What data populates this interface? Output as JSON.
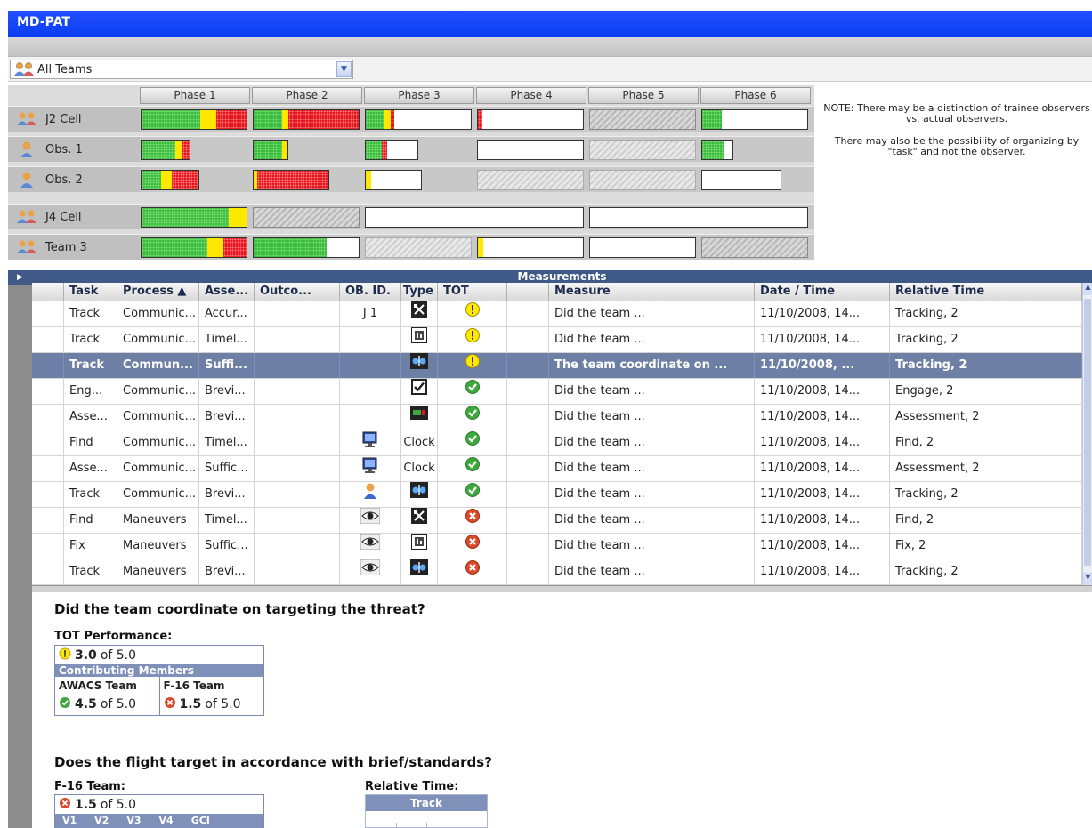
{
  "app": {
    "title": "MD-PAT"
  },
  "team_selector": {
    "value": "All Teams",
    "icon": "team-group-icon"
  },
  "phases": [
    "Phase 1",
    "Phase 2",
    "Phase 3",
    "Phase 4",
    "Phase 5",
    "Phase 6"
  ],
  "phase_rows": [
    {
      "label": "J2 Cell",
      "icon": "team-group-icon"
    },
    {
      "label": "Obs. 1",
      "icon": "single-observer-icon"
    },
    {
      "label": "Obs. 2",
      "icon": "single-observer-icon"
    },
    {
      "label": "J4 Cell",
      "icon": "team-group-icon"
    },
    {
      "label": "Team 3",
      "icon": "team-group-icon"
    }
  ],
  "note": {
    "line1": "NOTE:  There may be a distinction of trainee observers vs. actual observers.",
    "line2": "There may also be the possibility of organizing by \"task\" and not the observer."
  },
  "measurements": {
    "title": "Measurements",
    "columns": [
      "Task",
      "Process ▲",
      "Asse...",
      "Outco...",
      "OB. ID.",
      "Type",
      "TOT",
      "",
      "Measure",
      "Date / Time",
      "Relative Time"
    ],
    "rows": [
      {
        "task": "Track",
        "process": "Communic...",
        "asse": "Accur...",
        "outco": "",
        "obid": "J 1",
        "obicon": "",
        "type": "",
        "typeicon": "x-axis-icon",
        "tot": "warning",
        "measure": "Did the team ...",
        "date": "11/10/2008, 14...",
        "rel": "Tracking, 2",
        "selected": false
      },
      {
        "task": "Track",
        "process": "Communic...",
        "asse": "Timel...",
        "outco": "",
        "obid": "",
        "obicon": "",
        "type": "",
        "typeicon": "chart-box-icon",
        "tot": "warning",
        "measure": "Did the team ...",
        "date": "11/10/2008, 14...",
        "rel": "Tracking, 2",
        "selected": false
      },
      {
        "task": "Track",
        "process": "Commun...",
        "asse": "Suffi...",
        "outco": "",
        "obid": "",
        "obicon": "",
        "type": "",
        "typeicon": "slider-icon",
        "tot": "warning",
        "measure": "The team coordinate on ...",
        "date": "11/10/2008, ...",
        "rel": "Tracking, 2",
        "selected": true
      },
      {
        "task": "Eng...",
        "process": "Communic...",
        "asse": "Brevi...",
        "outco": "",
        "obid": "",
        "obicon": "",
        "type": "",
        "typeicon": "checkbox-icon",
        "tot": "ok",
        "measure": "Did the team ...",
        "date": "11/10/2008, 14...",
        "rel": "Engage, 2",
        "selected": false
      },
      {
        "task": "Asse...",
        "process": "Communic...",
        "asse": "Brevi...",
        "outco": "",
        "obid": "",
        "obicon": "",
        "type": "",
        "typeicon": "dots-icon",
        "tot": "ok",
        "measure": "Did the team ...",
        "date": "11/10/2008, 14...",
        "rel": "Assessment, 2",
        "selected": false
      },
      {
        "task": "Find",
        "process": "Communic...",
        "asse": "Timel...",
        "outco": "",
        "obid": "",
        "obicon": "computer-icon",
        "type": "Clock",
        "typeicon": "",
        "tot": "ok",
        "measure": "Did the team ...",
        "date": "11/10/2008, 14...",
        "rel": "Find, 2",
        "selected": false
      },
      {
        "task": "Asse...",
        "process": "Communic...",
        "asse": "Suffic...",
        "outco": "",
        "obid": "",
        "obicon": "computer-icon",
        "type": "Clock",
        "typeicon": "",
        "tot": "ok",
        "measure": "Did the team ...",
        "date": "11/10/2008, 14...",
        "rel": "Assessment, 2",
        "selected": false
      },
      {
        "task": "Track",
        "process": "Communic...",
        "asse": "Brevi...",
        "outco": "",
        "obid": "",
        "obicon": "person-icon",
        "type": "",
        "typeicon": "slider-icon",
        "tot": "ok",
        "measure": "Did the team ...",
        "date": "11/10/2008, 14...",
        "rel": "Tracking, 2",
        "selected": false
      },
      {
        "task": "Find",
        "process": "Maneuvers",
        "asse": "Timel...",
        "outco": "",
        "obid": "",
        "obicon": "eye-icon",
        "type": "",
        "typeicon": "x-axis-icon",
        "tot": "fail",
        "measure": "Did the team ...",
        "date": "11/10/2008, 14...",
        "rel": "Find, 2",
        "selected": false
      },
      {
        "task": "Fix",
        "process": "Maneuvers",
        "asse": "Suffic...",
        "outco": "",
        "obid": "",
        "obicon": "eye-icon",
        "type": "",
        "typeicon": "chart-box-icon",
        "tot": "fail",
        "measure": "Did the team ...",
        "date": "11/10/2008, 14...",
        "rel": "Fix, 2",
        "selected": false
      },
      {
        "task": "Track",
        "process": "Maneuvers",
        "asse": "Brevi...",
        "outco": "",
        "obid": "",
        "obicon": "eye-icon",
        "type": "",
        "typeicon": "slider-icon",
        "tot": "fail",
        "measure": "Did the team ...",
        "date": "11/10/2008, 14...",
        "rel": "Tracking, 2",
        "selected": false
      }
    ]
  },
  "detail": {
    "q1": "Did the team coordinate on targeting the threat?",
    "tot_label": "TOT Performance:",
    "tot_score": "3.0",
    "of": "of 5.0",
    "contributing": "Contributing Members",
    "team_a_name": "AWACS Team",
    "team_a_score": "4.5",
    "team_b_name": "F-16 Team",
    "team_b_score": "1.5",
    "q2": "Does the flight target in accordance with brief/standards?",
    "f16_label": "F-16 Team:",
    "f16_score": "1.5",
    "v_labels": [
      "V1",
      "V2",
      "V3",
      "V4",
      "GCI"
    ],
    "rel_label": "Relative Time:",
    "rel_head": "Track"
  },
  "colors": {
    "title_blue": "#0a3cf2",
    "header_navy": "#3f5a86",
    "selected_row": "#6e7fa6",
    "good": "#3bbd3b",
    "warn": "#ffe800",
    "bad": "#e3161f"
  }
}
